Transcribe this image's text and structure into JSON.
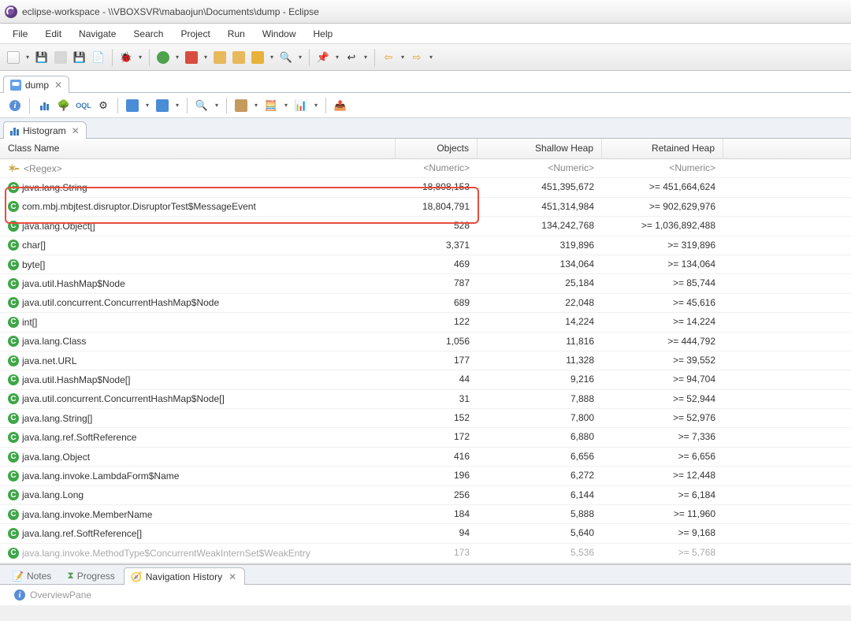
{
  "window": {
    "title": "eclipse-workspace - \\\\VBOXSVR\\mabaojun\\Documents\\dump - Eclipse"
  },
  "menu": [
    "File",
    "Edit",
    "Navigate",
    "Search",
    "Project",
    "Run",
    "Window",
    "Help"
  ],
  "editor_tab": {
    "label": "dump",
    "close": "✕"
  },
  "mat_toolbar": {
    "info": "i"
  },
  "histogram_tab": {
    "label": "Histogram",
    "close": "✕"
  },
  "columns": {
    "class": "Class Name",
    "objects": "Objects",
    "shallow": "Shallow Heap",
    "retained": "Retained Heap"
  },
  "regex_row": {
    "class": "<Regex>",
    "objects": "<Numeric>",
    "shallow": "<Numeric>",
    "retained": "<Numeric>"
  },
  "rows": [
    {
      "class": "java.lang.String",
      "objects": "18,808,153",
      "shallow": "451,395,672",
      "retained": ">= 451,664,624"
    },
    {
      "class": "com.mbj.mbjtest.disruptor.DisruptorTest$MessageEvent",
      "objects": "18,804,791",
      "shallow": "451,314,984",
      "retained": ">= 902,629,976"
    },
    {
      "class": "java.lang.Object[]",
      "objects": "528",
      "shallow": "134,242,768",
      "retained": ">= 1,036,892,488"
    },
    {
      "class": "char[]",
      "objects": "3,371",
      "shallow": "319,896",
      "retained": ">= 319,896"
    },
    {
      "class": "byte[]",
      "objects": "469",
      "shallow": "134,064",
      "retained": ">= 134,064"
    },
    {
      "class": "java.util.HashMap$Node",
      "objects": "787",
      "shallow": "25,184",
      "retained": ">= 85,744"
    },
    {
      "class": "java.util.concurrent.ConcurrentHashMap$Node",
      "objects": "689",
      "shallow": "22,048",
      "retained": ">= 45,616"
    },
    {
      "class": "int[]",
      "objects": "122",
      "shallow": "14,224",
      "retained": ">= 14,224"
    },
    {
      "class": "java.lang.Class",
      "objects": "1,056",
      "shallow": "11,816",
      "retained": ">= 444,792"
    },
    {
      "class": "java.net.URL",
      "objects": "177",
      "shallow": "11,328",
      "retained": ">= 39,552"
    },
    {
      "class": "java.util.HashMap$Node[]",
      "objects": "44",
      "shallow": "9,216",
      "retained": ">= 94,704"
    },
    {
      "class": "java.util.concurrent.ConcurrentHashMap$Node[]",
      "objects": "31",
      "shallow": "7,888",
      "retained": ">= 52,944"
    },
    {
      "class": "java.lang.String[]",
      "objects": "152",
      "shallow": "7,800",
      "retained": ">= 52,976"
    },
    {
      "class": "java.lang.ref.SoftReference",
      "objects": "172",
      "shallow": "6,880",
      "retained": ">= 7,336"
    },
    {
      "class": "java.lang.Object",
      "objects": "416",
      "shallow": "6,656",
      "retained": ">= 6,656"
    },
    {
      "class": "java.lang.invoke.LambdaForm$Name",
      "objects": "196",
      "shallow": "6,272",
      "retained": ">= 12,448"
    },
    {
      "class": "java.lang.Long",
      "objects": "256",
      "shallow": "6,144",
      "retained": ">= 6,184"
    },
    {
      "class": "java.lang.invoke.MemberName",
      "objects": "184",
      "shallow": "5,888",
      "retained": ">= 11,960"
    },
    {
      "class": "java.lang.ref.SoftReference[]",
      "objects": "94",
      "shallow": "5,640",
      "retained": ">= 9,168"
    },
    {
      "class": "java.lang.invoke.MethodType$ConcurrentWeakInternSet$WeakEntry",
      "objects": "173",
      "shallow": "5,536",
      "retained": ">= 5,768"
    }
  ],
  "highlight_row_index": 1,
  "bottom_tabs": {
    "notes": "Notes",
    "progress": "Progress",
    "navhist": "Navigation History",
    "close": "✕"
  },
  "bottom_content": {
    "label": "OverviewPane"
  },
  "icons": {
    "info": "i"
  }
}
